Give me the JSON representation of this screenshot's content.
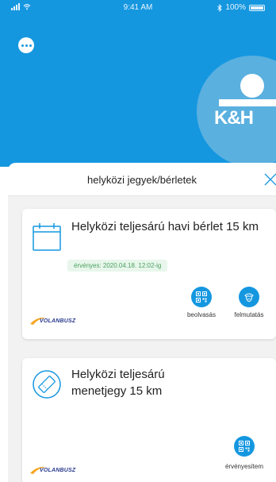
{
  "status_bar": {
    "time": "9:41 AM",
    "battery": "100%"
  },
  "logo": {
    "text": "K&H"
  },
  "sheet": {
    "title": "helyközi jegyek/bérletek"
  },
  "tickets": [
    {
      "title": "Helyközi teljesárú havi bérlet 15 km",
      "validity": "érvényes: 2020.04.18. 12:02-ig",
      "brand": "VOLANBUSZ",
      "actions": [
        {
          "label": "beolvasás",
          "icon": "qr-code-icon"
        },
        {
          "label": "felmutatás",
          "icon": "conductor-icon"
        }
      ]
    },
    {
      "title": "Helyközi teljesárú menetjegy 15 km",
      "brand": "VOLANBUSZ",
      "actions": [
        {
          "label": "érvényesítem",
          "icon": "qr-code-icon"
        }
      ]
    }
  ],
  "colors": {
    "hero": "#1597e0",
    "accent": "#1597e0",
    "validity_text": "#4aa15e",
    "validity_bg": "#e8f6ec"
  }
}
